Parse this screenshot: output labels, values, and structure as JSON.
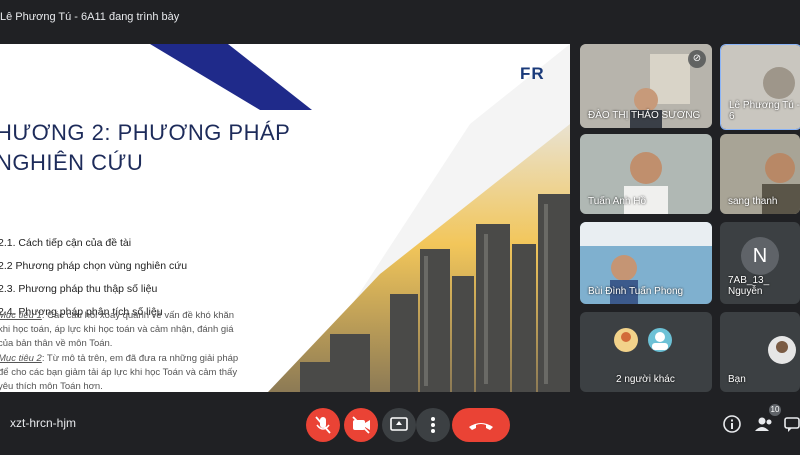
{
  "presenter_label": "Lê Phương Tú - 6A11 đang trình bày",
  "slide": {
    "logo": "FR",
    "title_line1": "HƯƠNG 2: PHƯƠNG PHÁP",
    "title_line2": "NGHIÊN CỨU",
    "bullets": [
      "2.1. Cách tiếp cận của đề tài",
      "2.2 Phương pháp chọn vùng nghiên cứu",
      "2.3. Phương pháp thu thập số liệu",
      "2.4. Phương pháp phân tích số liệu"
    ],
    "goal1_label": "Mục tiêu 1",
    "goal1_text": ": Các câu hỏi xoay quanh về vấn đề khó khăn khi học toán, áp lực khi học toán và cảm nhận, đánh giá của bản thân về môn Toán.",
    "goal2_label": "Mục tiêu 2",
    "goal2_text": ": Từ mô tả trên, em đã đưa ra những giải pháp để cho các bạn giảm tải áp lực khi học Toán và cảm thấy yêu thích môn Toán hơn."
  },
  "participants": [
    {
      "name": "ĐÀO THỊ THẢO SƯƠNG"
    },
    {
      "name": "Lê Phương Tú - 6"
    },
    {
      "name": "Tuấn Anh Hồ"
    },
    {
      "name": "sang thanh"
    },
    {
      "name": "Bùi Đình Tuấn Phong"
    },
    {
      "name": "7AB_13_ Nguyễn",
      "initial": "N"
    },
    {
      "name": "2 người khác"
    },
    {
      "name": "Bạn"
    }
  ],
  "participant_count": "10",
  "meeting_code": "xzt-hrcn-hjm",
  "icons": {
    "mic": "mic-off-icon",
    "camera": "camera-off-icon",
    "present": "present-icon",
    "more": "more-vert-icon",
    "hangup": "call-end-icon",
    "info": "info-icon",
    "people": "people-icon",
    "chat": "chat-icon"
  },
  "colors": {
    "background": "#202124",
    "danger": "#ea4335",
    "tile": "#3c4043",
    "slide_title": "#1d2b5a"
  }
}
